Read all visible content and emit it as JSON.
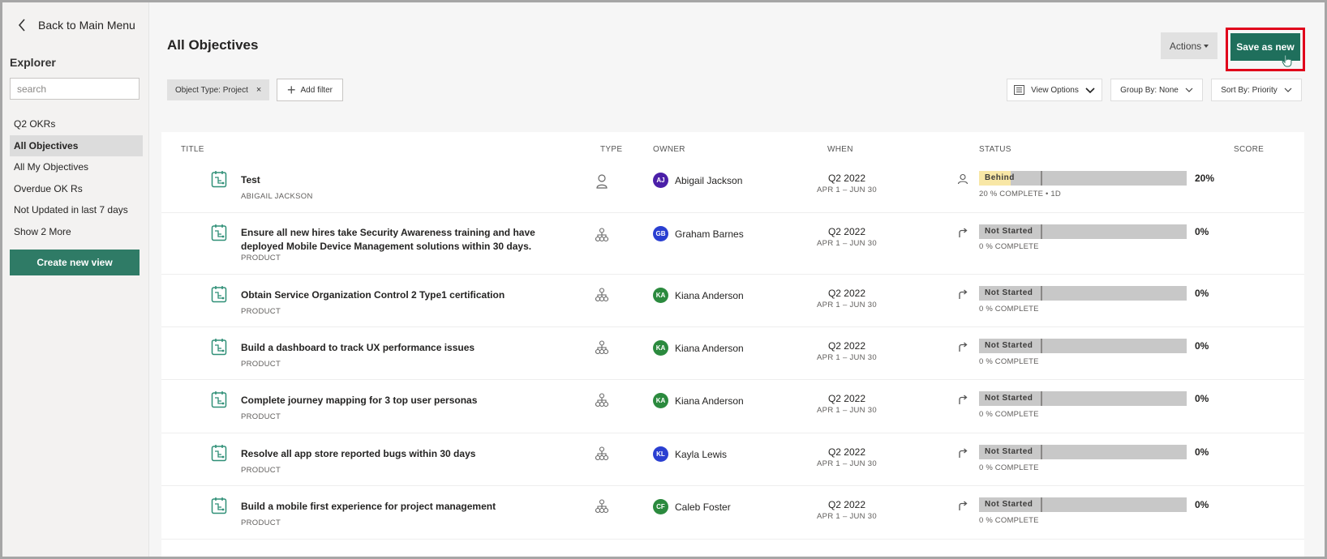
{
  "sidebar": {
    "back_label": "Back to Main Menu",
    "heading": "Explorer",
    "search_placeholder": "search",
    "items": [
      {
        "label": "Q2 OKRs",
        "active": false
      },
      {
        "label": "All Objectives",
        "active": true
      },
      {
        "label": "All My Objectives",
        "active": false
      },
      {
        "label": "Overdue OK Rs",
        "active": false
      },
      {
        "label": "Not Updated in last 7 days",
        "active": false
      },
      {
        "label": "Show 2 More",
        "active": false
      }
    ],
    "create_label": "Create new view"
  },
  "header": {
    "title": "All Objectives",
    "actions_label": "Actions",
    "save_label": "Save as new"
  },
  "filters": {
    "chip_label": "Object Type: Project",
    "chip_remove": "×",
    "add_filter_label": "Add filter",
    "view_options_label": "View Options",
    "group_by_label": "Group By:  None",
    "sort_by_label": "Sort By:  Priority"
  },
  "table": {
    "columns": {
      "title": "TITLE",
      "type": "TYPE",
      "owner": "OWNER",
      "when": "WHEN",
      "status": "STATUS",
      "score": "SCORE"
    },
    "rows": [
      {
        "title": "Test",
        "subtitle": "ABIGAIL JACKSON",
        "type_icon": "person-icon",
        "initials": "AJ",
        "avatar_color": "#4b1fa8",
        "owner": "Abigail Jackson",
        "quarter": "Q2 2022",
        "dates": "APR 1 – JUN 30",
        "status_icon": "person-icon",
        "status": "Behind",
        "status_fill": "#f8e7a6",
        "progress": 0.2,
        "pct": "20%",
        "status_sub": "20 % COMPLETE • 1D"
      },
      {
        "title": "Ensure all new hires take Security Awareness training and have deployed Mobile Device Management solutions within 30 days.",
        "subtitle": "PRODUCT",
        "type_icon": "org-icon",
        "initials": "GB",
        "avatar_color": "#2a3fd1",
        "owner": "Graham Barnes",
        "quarter": "Q2 2022",
        "dates": "APR 1 – JUN 30",
        "status_icon": "redirect-arrow-icon",
        "status": "Not Started",
        "status_fill": "#c8c8c8",
        "progress": 0,
        "pct": "0%",
        "status_sub": "0 % COMPLETE"
      },
      {
        "title": "Obtain Service Organization Control 2 Type1 certification",
        "subtitle": "PRODUCT",
        "type_icon": "org-icon",
        "initials": "KA",
        "avatar_color": "#2b8a3e",
        "owner": "Kiana Anderson",
        "quarter": "Q2 2022",
        "dates": "APR 1 – JUN 30",
        "status_icon": "redirect-arrow-icon",
        "status": "Not Started",
        "status_fill": "#c8c8c8",
        "progress": 0,
        "pct": "0%",
        "status_sub": "0 % COMPLETE"
      },
      {
        "title": "Build a dashboard to track UX performance issues",
        "subtitle": "PRODUCT",
        "type_icon": "org-icon",
        "initials": "KA",
        "avatar_color": "#2b8a3e",
        "owner": "Kiana Anderson",
        "quarter": "Q2 2022",
        "dates": "APR 1 – JUN 30",
        "status_icon": "redirect-arrow-icon",
        "status": "Not Started",
        "status_fill": "#c8c8c8",
        "progress": 0,
        "pct": "0%",
        "status_sub": "0 % COMPLETE"
      },
      {
        "title": "Complete journey mapping for 3 top user personas",
        "subtitle": "PRODUCT",
        "type_icon": "org-icon",
        "initials": "KA",
        "avatar_color": "#2b8a3e",
        "owner": "Kiana Anderson",
        "quarter": "Q2 2022",
        "dates": "APR 1 – JUN 30",
        "status_icon": "redirect-arrow-icon",
        "status": "Not Started",
        "status_fill": "#c8c8c8",
        "progress": 0,
        "pct": "0%",
        "status_sub": "0 % COMPLETE"
      },
      {
        "title": "Resolve all app store reported bugs within 30 days",
        "subtitle": "PRODUCT",
        "type_icon": "org-icon",
        "initials": "KL",
        "avatar_color": "#2a3fd1",
        "owner": "Kayla Lewis",
        "quarter": "Q2 2022",
        "dates": "APR 1 – JUN 30",
        "status_icon": "redirect-arrow-icon",
        "status": "Not Started",
        "status_fill": "#c8c8c8",
        "progress": 0,
        "pct": "0%",
        "status_sub": "0 % COMPLETE"
      },
      {
        "title": "Build a mobile first experience for project management",
        "subtitle": "PRODUCT",
        "type_icon": "org-icon",
        "initials": "CF",
        "avatar_color": "#2b8a3e",
        "owner": "Caleb Foster",
        "quarter": "Q2 2022",
        "dates": "APR 1 – JUN 30",
        "status_icon": "redirect-arrow-icon",
        "status": "Not Started",
        "status_fill": "#c8c8c8",
        "progress": 0,
        "pct": "0%",
        "status_sub": "0 % COMPLETE"
      }
    ]
  }
}
